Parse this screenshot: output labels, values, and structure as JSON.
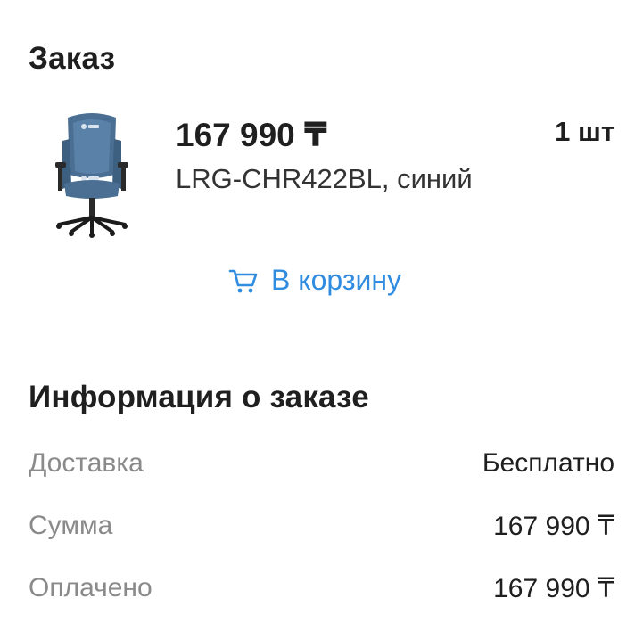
{
  "order": {
    "title": "Заказ",
    "item": {
      "price": "167 990 ₸",
      "name": "LRG-CHR422BL, синий",
      "quantity": "1 шт"
    },
    "cart_button_label": "В корзину"
  },
  "info": {
    "title": "Информация о заказе",
    "rows": [
      {
        "label": "Доставка",
        "value": "Бесплатно"
      },
      {
        "label": "Сумма",
        "value": "167 990 ₸"
      },
      {
        "label": "Оплачено",
        "value": "167 990 ₸"
      }
    ]
  },
  "colors": {
    "accent": "#2f8ce0",
    "muted": "#8a8a8a",
    "text": "#1f1f1f",
    "chair": "#4a6f93"
  },
  "icons": {
    "cart": "cart-icon",
    "product": "gaming-chair-image"
  }
}
